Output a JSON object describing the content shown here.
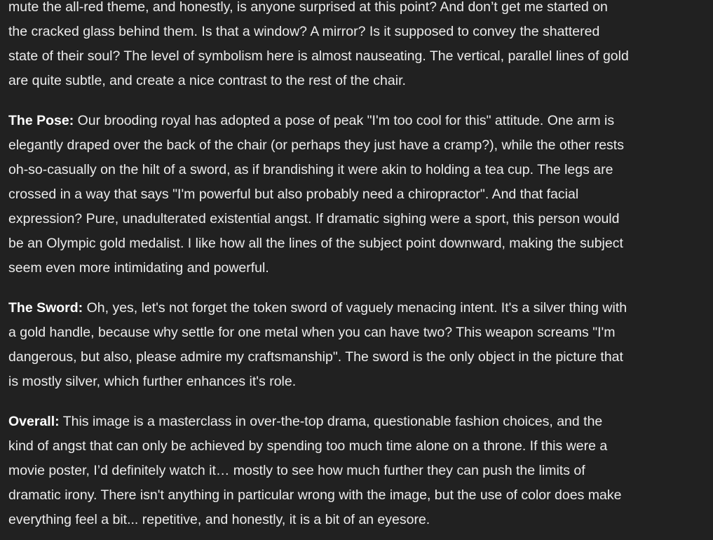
{
  "paragraphs": [
    {
      "heading": "",
      "lines": [
        "mute the all-red theme, and honestly, is anyone surprised at this point? And don’t get me started on",
        "the cracked glass behind them. Is that a window? A mirror? Is it supposed to convey the shattered",
        "state of their soul? The level of symbolism here is almost nauseating. The vertical, parallel lines of gold",
        "are quite subtle, and create a nice contrast to the rest of the chair."
      ]
    },
    {
      "heading": "The Pose:",
      "lines": [
        " Our brooding royal has adopted a pose of peak \"I'm too cool for this\" attitude. One arm is",
        "elegantly draped over the back of the chair (or perhaps they just have a cramp?), while the other rests",
        "oh-so-casually on the hilt of a sword, as if brandishing it were akin to holding a tea cup. The legs are",
        "crossed in a way that says \"I'm powerful but also probably need a chiropractor\". And that facial",
        "expression? Pure, unadulterated existential angst. If dramatic sighing were a sport, this person would",
        "be an Olympic gold medalist. I like how all the lines of the subject point downward, making the subject",
        "seem even more intimidating and powerful."
      ]
    },
    {
      "heading": "The Sword:",
      "lines": [
        " Oh, yes, let's not forget the token sword of vaguely menacing intent. It's a silver thing with",
        "a gold handle, because why settle for one metal when you can have two? This weapon screams \"I'm",
        "dangerous, but also, please admire my craftsmanship\". The sword is the only object in the picture that",
        "is mostly silver, which further enhances it's role."
      ]
    },
    {
      "heading": "Overall:",
      "lines": [
        " This image is a masterclass in over-the-top drama, questionable fashion choices, and the",
        "kind of angst that can only be achieved by spending too much time alone on a throne. If this were a",
        "movie poster, I’d definitely watch it… mostly to see how much further they can push the limits of",
        "dramatic irony. There isn't anything in particular wrong with the image, but the use of color does make",
        "everything feel a bit... repetitive, and honestly, it is a bit of an eyesore."
      ]
    }
  ]
}
